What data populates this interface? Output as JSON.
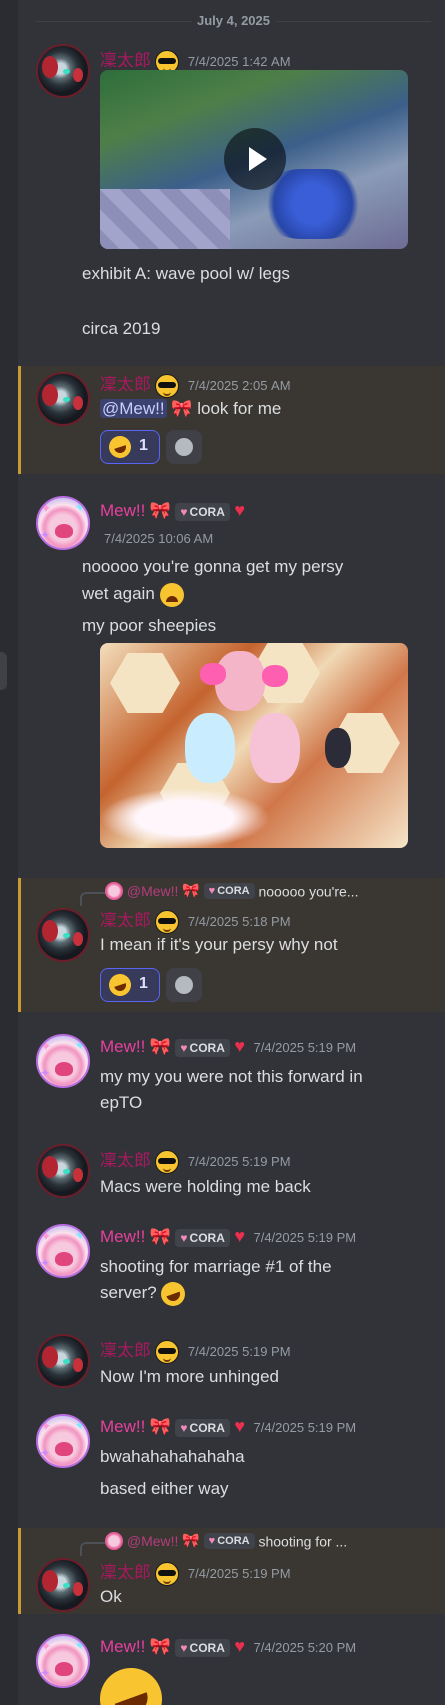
{
  "date_divider": "July 4, 2025",
  "users": {
    "rin": "凜太郎",
    "mew": "Mew!!",
    "tag": "CORA"
  },
  "colors": {
    "background": "#323339",
    "highlight": "#3a3631",
    "highlight_bar": "#c89a34",
    "rin_name": "#a8195d",
    "mew_name": "#e6409c",
    "mention_bg": "#3c4270"
  },
  "messages": [
    {
      "author": "凜太郎",
      "timestamp": "7/4/2025 1:42 AM",
      "attachment": "video",
      "lines": [
        "exhibit A: wave pool w/ legs",
        "circa 2019"
      ]
    },
    {
      "author": "凜太郎",
      "timestamp": "7/4/2025 2:05 AM",
      "mention": "@Mew!!",
      "text_after": "look for me",
      "reaction_count": "1"
    },
    {
      "author": "Mew!!",
      "timestamp": "7/4/2025 10:06 AM",
      "lines": [
        "nooooo you're gonna get my persy",
        "wet again",
        "my poor sheepies"
      ],
      "attachment": "image"
    },
    {
      "author": "凜太郎",
      "reply_to": "@Mew!!",
      "reply_tag": "CORA",
      "reply_excerpt": "nooooo you're...",
      "timestamp": "7/4/2025 5:18 PM",
      "text": "I mean if it's your persy why not",
      "reaction_count": "1"
    },
    {
      "author": "Mew!!",
      "timestamp": "7/4/2025 5:19 PM",
      "lines": [
        "my my you were not this forward in",
        "epTO"
      ]
    },
    {
      "author": "凜太郎",
      "timestamp": "7/4/2025 5:19 PM",
      "text": "Macs were holding me back"
    },
    {
      "author": "Mew!!",
      "timestamp": "7/4/2025 5:19 PM",
      "lines": [
        "shooting for marriage #1 of the",
        "server?"
      ]
    },
    {
      "author": "凜太郎",
      "timestamp": "7/4/2025 5:19 PM",
      "text": "Now I'm more unhinged"
    },
    {
      "author": "Mew!!",
      "timestamp": "7/4/2025 5:19 PM",
      "lines": [
        "bwahahahahahaha",
        "based either way"
      ]
    },
    {
      "author": "凜太郎",
      "reply_to": "@Mew!!",
      "reply_tag": "CORA",
      "reply_excerpt": "shooting for ...",
      "timestamp": "7/4/2025 5:19 PM",
      "text": "Ok"
    },
    {
      "author": "Mew!!",
      "timestamp": "7/4/2025 5:20 PM",
      "emoji_only": "rolling-on-floor-laughing"
    }
  ]
}
